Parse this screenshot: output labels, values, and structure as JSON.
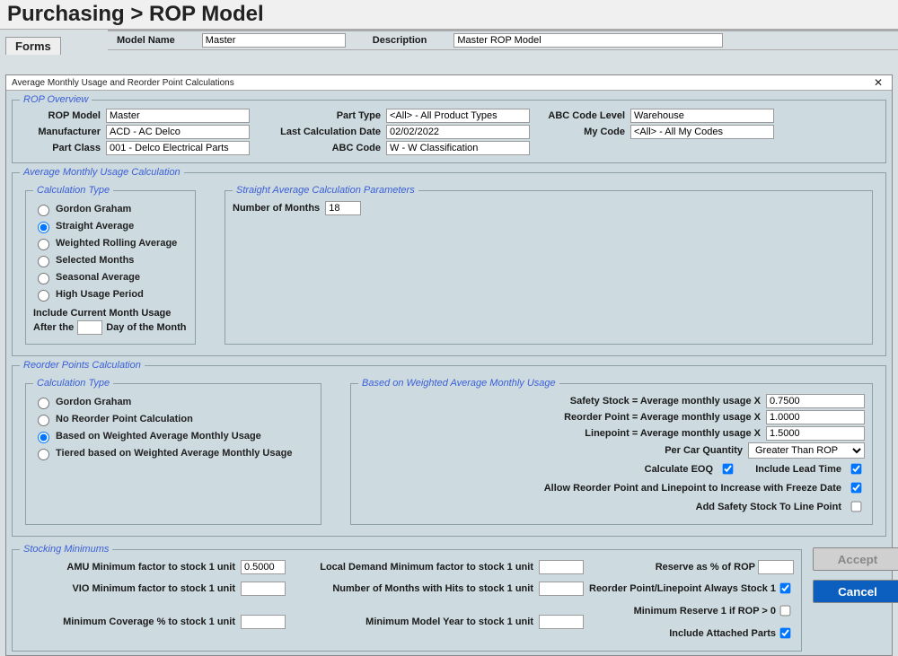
{
  "breadcrumb": "Purchasing > ROP Model",
  "forms_tab": "Forms",
  "header": {
    "model_name_lbl": "Model Name",
    "model_name_val": "Master",
    "description_lbl": "Description",
    "description_val": "Master ROP Model"
  },
  "dialog_title": "Average Monthly Usage and Reorder Point Calculations",
  "rop_overview": {
    "legend": "ROP Overview",
    "labels": {
      "rop_model": "ROP Model",
      "manufacturer": "Manufacturer",
      "part_class": "Part Class",
      "part_type": "Part Type",
      "last_calc": "Last Calculation Date",
      "abc_code": "ABC Code",
      "abc_level": "ABC Code Level",
      "my_code": "My Code"
    },
    "values": {
      "rop_model": "Master",
      "manufacturer": "ACD - AC Delco",
      "part_class": "001 - Delco Electrical Parts",
      "part_type": "<All> - All Product Types",
      "last_calc": "02/02/2022",
      "abc_code": "W - W Classification",
      "abc_level": "Warehouse",
      "my_code": "<All> - All My Codes"
    }
  },
  "amu": {
    "legend": "Average Monthly Usage Calculation",
    "calc_type_legend": "Calculation Type",
    "options": {
      "gordon": "Gordon Graham",
      "straight": "Straight Average",
      "weighted_rolling": "Weighted Rolling Average",
      "selected_months": "Selected Months",
      "seasonal": "Seasonal Average",
      "high_usage": "High Usage Period"
    },
    "include_line1": "Include Current Month Usage",
    "include_line2a": "After the",
    "include_line2b": "Day of the Month",
    "include_day": "",
    "params_legend": "Straight Average Calculation Parameters",
    "num_months_lbl": "Number of Months",
    "num_months_val": "18"
  },
  "rp": {
    "legend": "Reorder Points Calculation",
    "calc_type_legend": "Calculation Type",
    "options": {
      "gordon": "Gordon Graham",
      "none": "No Reorder Point Calculation",
      "weighted": "Based on Weighted Average Monthly Usage",
      "tiered": "Tiered based on Weighted Average Monthly Usage"
    },
    "params_legend": "Based on Weighted Average Monthly Usage",
    "labels": {
      "safety": "Safety Stock = Average monthly usage   X",
      "reorder": "Reorder Point = Average monthly usage   X",
      "linepoint": "Linepoint = Average monthly usage   X",
      "per_car": "Per Car Quantity",
      "calc_eoq": "Calculate EOQ",
      "lead_time": "Include Lead Time",
      "allow_increase": "Allow Reorder Point and Linepoint to Increase with Freeze Date",
      "add_safety": "Add Safety Stock To Line Point"
    },
    "values": {
      "safety": "0.7500",
      "reorder": "1.0000",
      "linepoint": "1.5000",
      "per_car": "Greater Than ROP"
    }
  },
  "stocking": {
    "legend": "Stocking Minimums",
    "labels": {
      "amu_min": "AMU Minimum factor to stock 1 unit",
      "vio_min": "VIO Minimum factor to stock 1 unit",
      "min_cov": "Minimum Coverage % to stock 1 unit",
      "local_demand": "Local Demand Minimum factor to stock 1 unit",
      "months_hits": "Number of Months with Hits to stock 1 unit",
      "min_model_year": "Minimum Model Year to stock 1 unit",
      "reserve_pct": "Reserve as % of ROP",
      "always_stock": "Reorder Point/Linepoint Always Stock 1",
      "min_reserve1": "Minimum Reserve 1 if ROP > 0",
      "include_attached": "Include Attached Parts"
    },
    "values": {
      "amu_min": "0.5000",
      "vio_min": "",
      "min_cov": "",
      "local_demand": "",
      "months_hits": "",
      "min_model_year": "",
      "reserve_pct": ""
    }
  },
  "buttons": {
    "accept": "Accept",
    "cancel": "Cancel"
  }
}
